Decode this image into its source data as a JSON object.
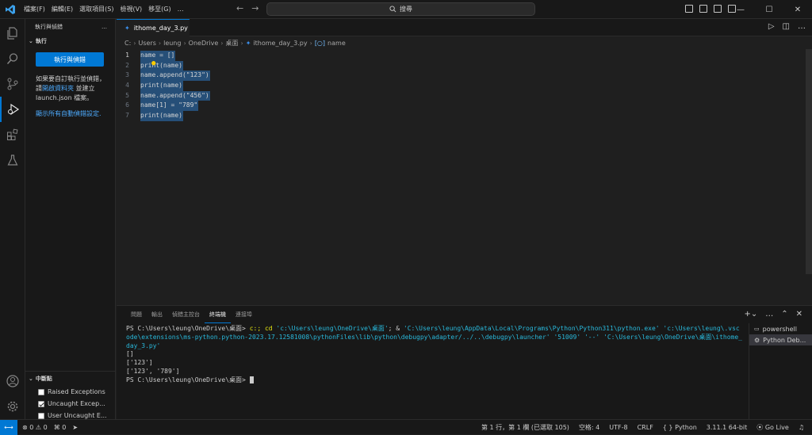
{
  "titlebar": {
    "menu": [
      "檔案(F)",
      "編輯(E)",
      "選取項目(S)",
      "檢視(V)",
      "移至(G)"
    ],
    "more": "…",
    "search_placeholder": "搜尋",
    "back": "←",
    "forward": "→",
    "minimize": "—",
    "maximize": "☐",
    "close": "✕"
  },
  "sidebar": {
    "header": "執行與偵錯",
    "section": "執行",
    "run_button": "執行與偵錯",
    "msg_part1": "如果要自訂執行並偵錯，請",
    "msg_link": "開啟資料夾",
    "msg_part2": " 並建立 launch.json 檔案。",
    "auto_link": "顯示所有自動偵錯設定.",
    "breakpoints_header": "中斷點",
    "breakpoints": [
      {
        "label": "Raised Exceptions",
        "checked": false
      },
      {
        "label": "Uncaught Excep...",
        "checked": true
      },
      {
        "label": "User Uncaught E...",
        "checked": false
      }
    ]
  },
  "editor": {
    "tab_label": "ithome_day_3.py",
    "breadcrumb": [
      "C:",
      "Users",
      "leung",
      "OneDrive",
      "桌面",
      "ithome_day_3.py",
      "name"
    ],
    "lines": [
      {
        "n": "1",
        "text": "name = []"
      },
      {
        "n": "2",
        "text": "print(name)"
      },
      {
        "n": "3",
        "text": "name.append(\"123\")"
      },
      {
        "n": "4",
        "text": "print(name)"
      },
      {
        "n": "5",
        "text": "name.append(\"456\")"
      },
      {
        "n": "6",
        "text": "name[1] = \"789\""
      },
      {
        "n": "7",
        "text": "print(name)"
      }
    ]
  },
  "panel": {
    "tabs": [
      "問題",
      "輸出",
      "偵錯主控台",
      "終端機",
      "連接埠"
    ],
    "active_tab": "終端機",
    "terminal_prompt": "PS C:\\Users\\leung\\OneDrive\\桌面> ",
    "terminal_cmd1": "c:; cd ",
    "terminal_path1": "'c:\\Users\\leung\\OneDrive\\桌面'",
    "terminal_sep": "; & ",
    "terminal_path2": "'C:\\Users\\leung\\AppData\\Local\\Programs\\Python\\Python311\\python.exe' 'c:\\Users\\leung\\.vscode\\extensions\\ms-python.python-2023.17.12581008\\pythonFiles\\lib\\python\\debugpy\\adapter/../..\\debugpy\\launcher' '51009' '--' 'C:\\Users\\leung\\OneDrive\\桌面\\ithome_day_3.py'",
    "output_lines": [
      "[]",
      "['123']",
      "['123', '789']"
    ],
    "terminal_prompt2": "PS C:\\Users\\leung\\OneDrive\\桌面> ",
    "terminals": [
      "powershell",
      "Python Deb..."
    ]
  },
  "statusbar": {
    "errors": "0",
    "warnings": "0",
    "ports": "0",
    "position": "第 1 行，第 1 欄 (已選取 105)",
    "spaces": "空格: 4",
    "encoding": "UTF-8",
    "eol": "CRLF",
    "language": "Python",
    "interpreter": "3.11.1 64-bit",
    "golive": "Go Live"
  },
  "colors": {
    "accent": "#0078d4",
    "selection": "#264f78",
    "link": "#4daafc"
  }
}
